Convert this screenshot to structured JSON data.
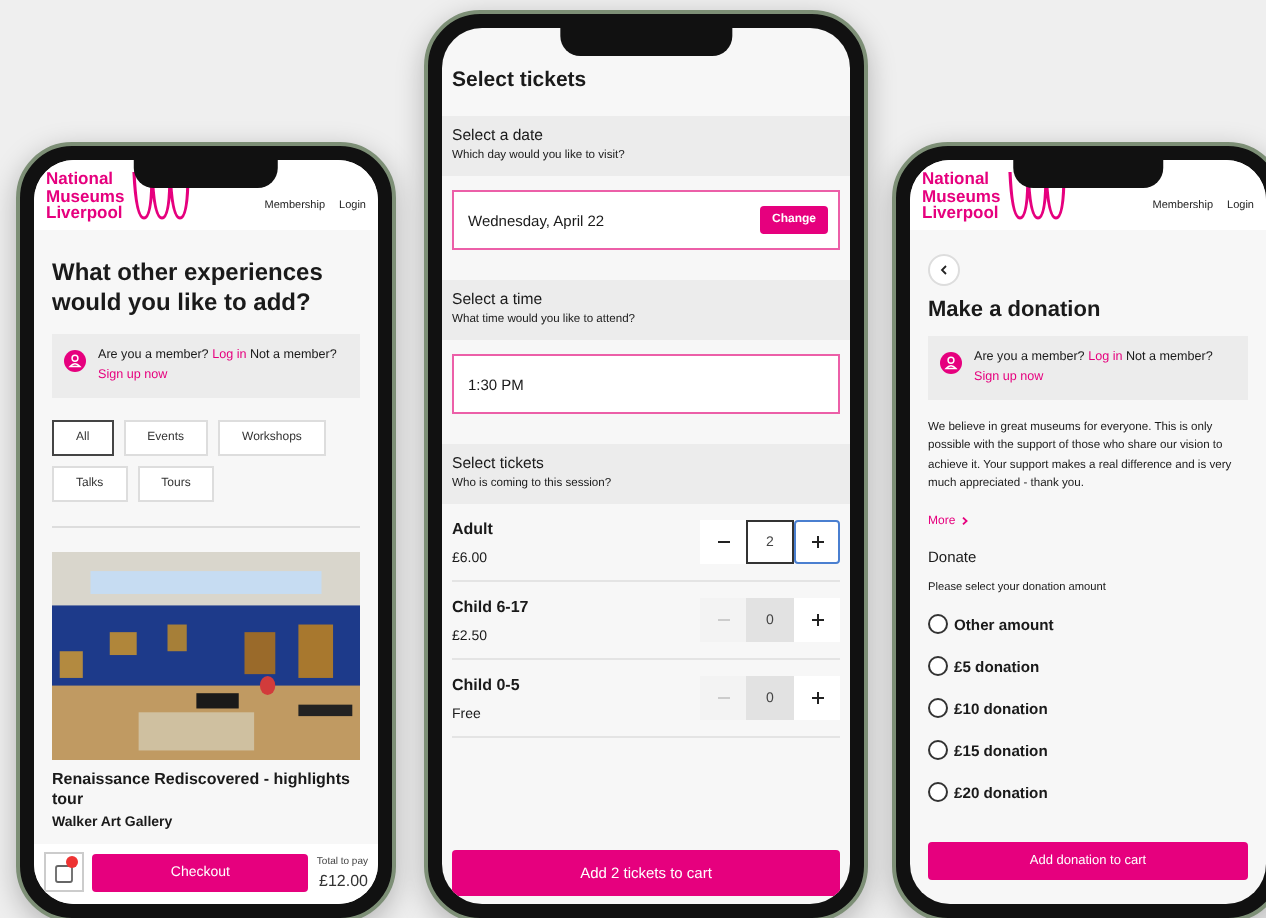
{
  "screens": [
    {
      "kind": "experiences",
      "header": {
        "logo": [
          "National",
          "Museums",
          "Liverpool"
        ],
        "nav": [
          "Membership",
          "Login"
        ]
      },
      "title": "What other experiences would you like to add?",
      "member": {
        "question": "Are you a member?",
        "login": "Log in",
        "prompt": "Not a member?",
        "signup": "Sign up now"
      },
      "filters": [
        {
          "label": "All",
          "selected": true
        },
        {
          "label": "Events",
          "selected": false
        },
        {
          "label": "Workshops",
          "selected": false
        },
        {
          "label": "Talks",
          "selected": false
        },
        {
          "label": "Tours",
          "selected": false
        }
      ],
      "card": {
        "kind": "picture",
        "title": "Renaissance Rediscovered - highlights tour",
        "venue": "Walker Art Gallery"
      },
      "footer": {
        "button": "Checkout",
        "total_label": "Total to pay",
        "total": "£12.00"
      }
    },
    {
      "kind": "tickets",
      "title": "Select tickets",
      "sections": [
        {
          "kind": "date",
          "heading": "Select a date",
          "subheading": "Which day would you like to visit?",
          "value": "Wednesday, April 22",
          "action": "Change"
        },
        {
          "kind": "time",
          "heading": "Select a time",
          "subheading": "What time would you like to attend?",
          "value": "1:30 PM"
        },
        {
          "kind": "quantities",
          "heading": "Select tickets",
          "subheading": "Who is coming to this session?",
          "rows": [
            {
              "label": "Adult",
              "price": "£6.00",
              "count": "2",
              "minus_disabled": false,
              "plus_focused": true
            },
            {
              "label": "Child 6-17",
              "price": "£2.50",
              "count": "0",
              "minus_disabled": true,
              "plus_focused": false
            },
            {
              "label": "Child 0-5",
              "price": "Free",
              "count": "0",
              "minus_disabled": true,
              "plus_focused": false
            }
          ]
        }
      ],
      "button": "Add 2 tickets to cart"
    },
    {
      "kind": "donation",
      "header": {
        "logo": [
          "National",
          "Museums",
          "Liverpool"
        ],
        "nav": [
          "Membership",
          "Login"
        ]
      },
      "title": "Make a donation",
      "member": {
        "question": "Are you a member?",
        "login": "Log in",
        "prompt": "Not a member?",
        "signup": "Sign up now"
      },
      "body": "We believe in great museums for everyone. This is only possible with the support of those who share our vision to achieve it. Your support makes a real difference and is very much appreciated - thank you.",
      "more": "More",
      "section": "Donate",
      "prompt": "Please select your donation amount",
      "options": [
        {
          "label": "Other amount",
          "selected": false
        },
        {
          "label": "£5 donation",
          "selected": false
        },
        {
          "label": "£10 donation",
          "selected": false
        },
        {
          "label": "£15 donation",
          "selected": false
        },
        {
          "label": "£20 donation",
          "selected": false
        }
      ],
      "button": "Add donation to cart"
    }
  ]
}
